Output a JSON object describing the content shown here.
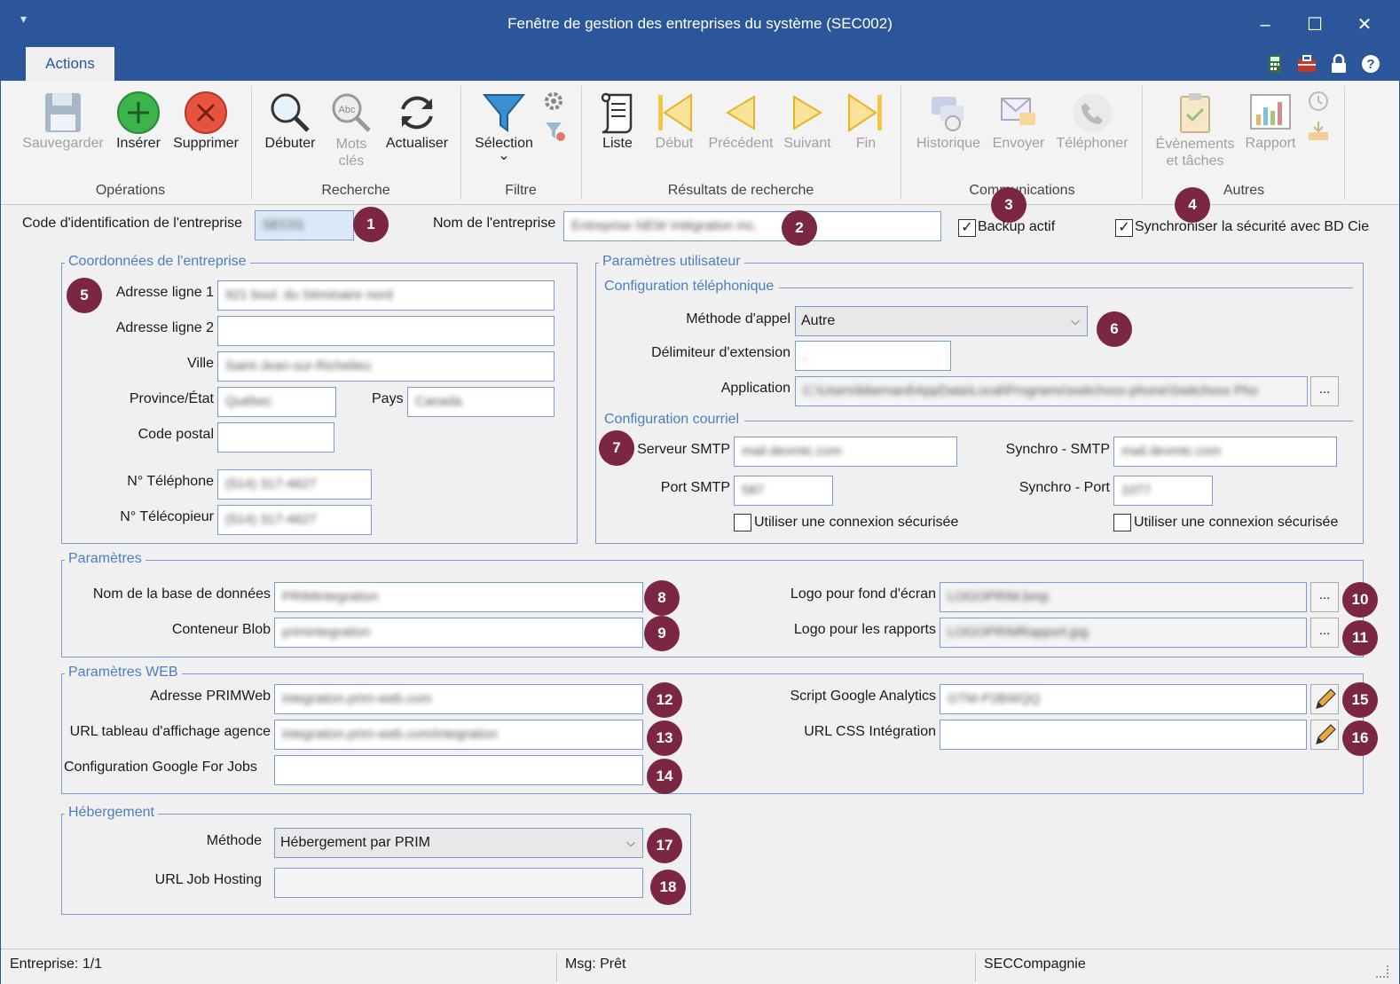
{
  "window": {
    "title": "Fenêtre de gestion des entreprises du système (SEC002)",
    "menu_glyph": "▾",
    "minimize": "–",
    "maximize": "☐",
    "close": "✕"
  },
  "ribbon_tabs": [
    "Actions"
  ],
  "ribbon": {
    "operations": {
      "label": "Opérations",
      "save": "Sauvegarder",
      "insert": "Insérer",
      "delete": "Supprimer"
    },
    "search": {
      "label": "Recherche",
      "start": "Débuter",
      "keywords": "Mots clés",
      "refresh": "Actualiser"
    },
    "filter": {
      "label": "Filtre",
      "selection": "Sélection",
      "chevron": "⌄"
    },
    "results": {
      "label": "Résultats de recherche",
      "list": "Liste",
      "first": "Début",
      "previous": "Précédent",
      "next": "Suivant",
      "last": "Fin"
    },
    "communications": {
      "label": "Communications",
      "history": "Historique",
      "send": "Envoyer",
      "phone": "Téléphoner"
    },
    "others": {
      "label": "Autres",
      "events": "Évènements et tâches",
      "report": "Rapport"
    }
  },
  "header": {
    "company_code_label": "Code d'identification de l'entreprise",
    "company_code_value": "SEC01",
    "company_name_label": "Nom de l'entreprise",
    "company_name_value": "Entreprise NEW Intégration inc.",
    "backup_label": "Backup actif",
    "backup_checked": "✓",
    "sync_label": "Synchroniser la sécurité avec BD Cie",
    "sync_checked": "✓"
  },
  "coordinates": {
    "legend": "Coordonnées de l'entreprise",
    "address1_label": "Adresse ligne 1",
    "address1_value": "921 boul. du Séminaire nord",
    "address2_label": "Adresse ligne 2",
    "address2_value": "",
    "city_label": "Ville",
    "city_value": "Saint-Jean-sur-Richelieu",
    "province_label": "Province/État",
    "province_value": "Québec",
    "country_label": "Pays",
    "country_value": "Canada",
    "postal_label": "Code postal",
    "postal_value": "",
    "phone_label": "N° Téléphone",
    "phone_value": "(514) 317-4627",
    "fax_label": "N° Télécopieur",
    "fax_value": "(514) 317-4627"
  },
  "user_params": {
    "legend": "Paramètres utilisateur",
    "phone_config_legend": "Configuration téléphonique",
    "call_method_label": "Méthode d'appel",
    "call_method_value": "Autre",
    "ext_delim_label": "Délimiteur d'extension",
    "ext_delim_value": ",",
    "application_label": "Application",
    "application_value": "C:\\Users\\bbernard\\AppData\\Local\\Programs\\switchvox-phone\\Switchvox Pho",
    "email_config_legend": "Configuration courriel",
    "smtp_server_label": "Serveur SMTP",
    "smtp_server_value": "mail.devmtc.com",
    "smtp_port_label": "Port SMTP",
    "smtp_port_value": "587",
    "smtp_secure_label": "Utiliser une connexion sécurisée",
    "sync_smtp_label": "Synchro - SMTP",
    "sync_smtp_value": "mail.devmtc.com",
    "sync_port_label": "Synchro - Port",
    "sync_port_value": "1077",
    "sync_secure_label": "Utiliser une connexion sécurisée"
  },
  "params": {
    "legend": "Paramètres",
    "db_name_label": "Nom de la base de données",
    "db_name_value": "PRIMIntegration",
    "blob_label": "Conteneur Blob",
    "blob_value": "primintegration",
    "bg_logo_label": "Logo pour fond d'écran",
    "bg_logo_value": "LOGOPRIM.bmp",
    "report_logo_label": "Logo pour les rapports",
    "report_logo_value": "LOGOPRIMRapport.jpg",
    "browse": "..."
  },
  "web_params": {
    "legend": "Paramètres WEB",
    "primweb_label": "Adresse PRIMWeb",
    "primweb_value": "integration.prim-web.com",
    "agency_url_label": "URL tableau d'affichage agence",
    "agency_url_value": "integration.prim-web.com/integration",
    "gfj_label": "Configuration Google For Jobs",
    "gfj_value": "",
    "analytics_label": "Script Google Analytics",
    "analytics_value": "GTM-P2BWQQ",
    "css_url_label": "URL CSS Intégration",
    "css_url_value": ""
  },
  "hosting": {
    "legend": "Hébergement",
    "method_label": "Méthode",
    "method_value": "Hébergement par PRIM",
    "job_url_label": "URL Job Hosting",
    "job_url_value": ""
  },
  "badges": [
    "1",
    "2",
    "3",
    "4",
    "5",
    "6",
    "7",
    "8",
    "9",
    "10",
    "11",
    "12",
    "13",
    "14",
    "15",
    "16",
    "17",
    "18"
  ],
  "status_bar": {
    "company": "Entreprise: 1/1",
    "message": "Msg: Prêt",
    "user": "SECCompagnie"
  },
  "colors": {
    "titlebar": "#2b579a",
    "badge": "#7b2744",
    "legend": "#4a7ec0"
  }
}
